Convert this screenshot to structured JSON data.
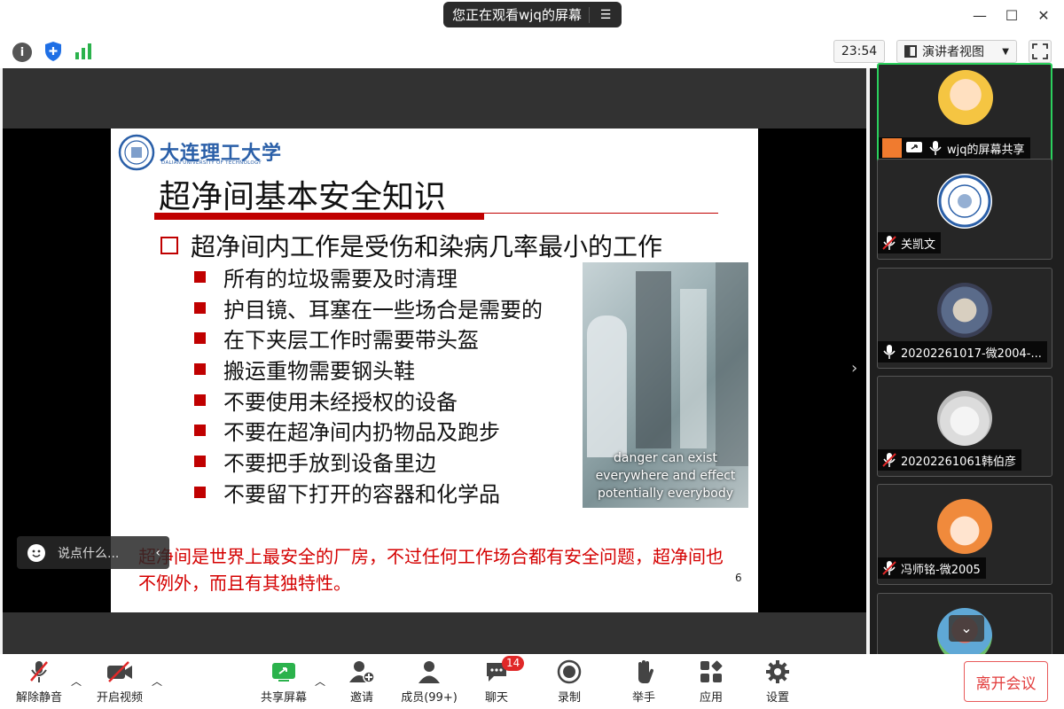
{
  "titlebar": {
    "share_status": "您正在观看wjq的屏幕",
    "minimize": "—",
    "maximize": "☐",
    "close": "✕"
  },
  "toolbar_top": {
    "clock": "23:54",
    "view_mode": "演讲者视图"
  },
  "slide": {
    "logo_text": "大连理工大学",
    "logo_subtext": "DALIAN UNIVERSITY OF TECHNOLOGY",
    "title": "超净间基本安全知识",
    "main_point": "超净间内工作是受伤和染病几率最小的工作",
    "sub_points": [
      "所有的垃圾需要及时清理",
      "护目镜、耳塞在一些场合是需要的",
      "在下夹层工作时需要带头盔",
      "搬运重物需要钢头鞋",
      "不要使用未经授权的设备",
      "不要在超净间内扔物品及跑步",
      "不要把手放到设备里边",
      "不要留下打开的容器和化学品"
    ],
    "photo_caption_1": "danger can exist",
    "photo_caption_2": "everywhere and effect",
    "photo_caption_3": "potentially everybody",
    "note": "超净间是世界上最安全的厂房，不过任何工作场合都有安全问题，超净间也不例外，而且有其独特性。",
    "page_number": "6"
  },
  "chat_input": {
    "placeholder": "说点什么..."
  },
  "participants": [
    {
      "name": "wjq的屏幕共享",
      "muted": false,
      "active": true
    },
    {
      "name": "关凯文",
      "muted": true,
      "active": false
    },
    {
      "name": "20202261017-微2004-...",
      "muted": false,
      "active": false
    },
    {
      "name": "20202261061韩伯彦",
      "muted": true,
      "active": false
    },
    {
      "name": "冯师铭-微2005",
      "muted": true,
      "active": false
    }
  ],
  "bottom_toolbar": {
    "unmute": "解除静音",
    "start_video": "开启视频",
    "share_screen": "共享屏幕",
    "invite": "邀请",
    "members": "成员(99+)",
    "chat": "聊天",
    "chat_badge": "14",
    "record": "录制",
    "raise_hand": "举手",
    "apps": "应用",
    "settings": "设置",
    "leave": "离开会议"
  },
  "colors": {
    "accent_red": "#c00000",
    "note_red": "#d40000",
    "active_green": "#2bd15d",
    "leave_red": "#e23b3b"
  }
}
